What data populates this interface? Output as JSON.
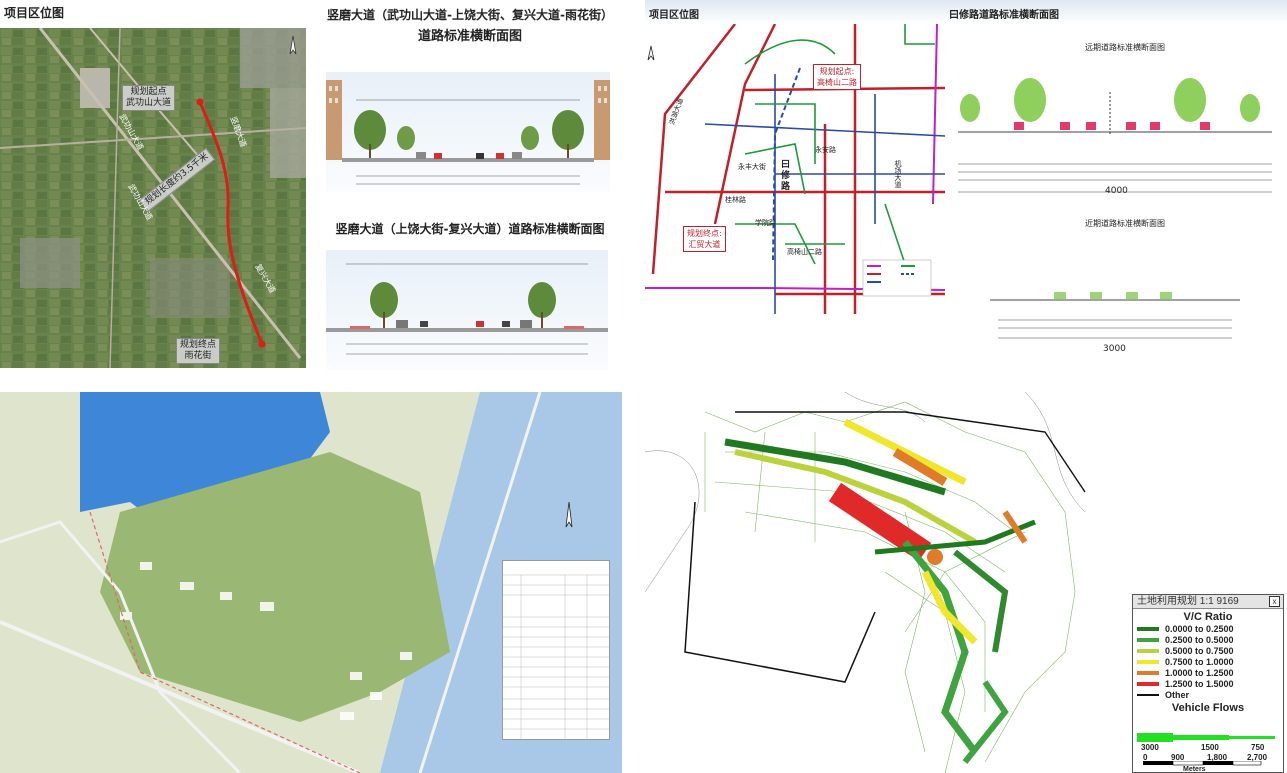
{
  "panel1": {
    "header": "项目区位图",
    "title1_line1": "竖磨大道（武功山大道-上饶大街、复兴大道-雨花街）",
    "title1_line2": "道路标准横断面图",
    "title2": "竖磨大道（上饶大街-复兴大道）道路标准横断面图",
    "start_label": "规划起点\n武功山大道",
    "end_label": "规划终点\n雨花街",
    "length_label": "规划长度约3.5千米",
    "road_labels": [
      "武功山大道",
      "竖磨大道",
      "复兴大道",
      "武功山大道"
    ]
  },
  "panel2": {
    "header": "项目区位图",
    "title": "曰修路道路标准横断面图",
    "far_title": "远期道路标准横断面图",
    "near_title": "近期道路标准横断面图",
    "far_total": "4000",
    "near_total": "3000",
    "start_label": "规划起点:\n高椅山二路",
    "end_label": "规划终点:\n汇贸大道",
    "road_name": "曰\n修\n路",
    "street_labels": [
      "永安路",
      "永丰大街",
      "桂林路",
      "学院路",
      "高椅山二路",
      "洪湖大道",
      "机场大道"
    ]
  },
  "panel4": {
    "window_title": "土地利用规划 1:1 9169",
    "close_glyph": "x",
    "vc_title": "V/C Ratio",
    "vc_items": [
      {
        "label": "0.0000 to 0.2500",
        "color": "#1f7a1f"
      },
      {
        "label": "0.2500 to 0.5000",
        "color": "#3fa33f"
      },
      {
        "label": "0.5000 to 0.7500",
        "color": "#bcd23c"
      },
      {
        "label": "0.7500 to 1.0000",
        "color": "#f0e62c"
      },
      {
        "label": "1.0000 to 1.2500",
        "color": "#e07b2a"
      },
      {
        "label": "1.2500 to 1.5000",
        "color": "#e02a2a"
      },
      {
        "label": "Other",
        "color": "#111111"
      }
    ],
    "vf_title": "Vehicle Flows",
    "vf_values": [
      "3000",
      "1500",
      "750"
    ],
    "scale_values": [
      "0",
      "900",
      "1,800",
      "2,700"
    ],
    "scale_unit": "Meters"
  }
}
